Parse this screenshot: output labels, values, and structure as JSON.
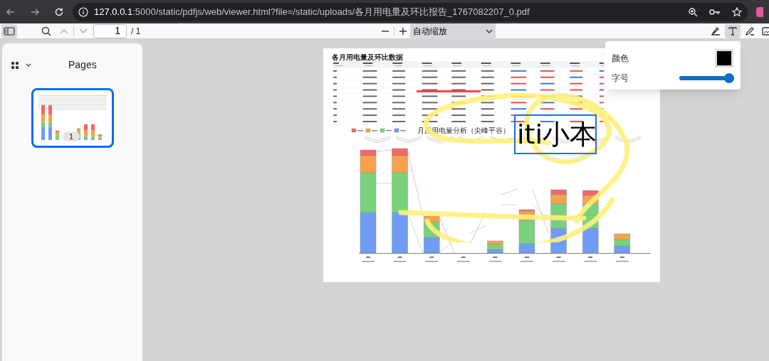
{
  "browser": {
    "url_host": "127.0.0.1",
    "url_rest": ":5000/static/pdfjs/web/viewer.html?file=/static/uploads/各月用电量及环比报告_1767082207_0.pdf"
  },
  "toolbar": {
    "sidebar_open": true,
    "page_number": "1",
    "page_count": "/ 1",
    "zoom": "自动缩放",
    "tools": [
      {
        "kind": "highlight",
        "selected": false
      },
      {
        "kind": "text",
        "selected": true
      },
      {
        "kind": "ink",
        "selected": false
      },
      {
        "kind": "image",
        "selected": false
      }
    ]
  },
  "sidebar": {
    "title": "Pages",
    "thumbnails": [
      {
        "label": "1",
        "selected": true
      }
    ]
  },
  "document": {
    "title": "各月用电量及环比数据",
    "chart": {
      "title": "月度用电量分析（尖峰平谷）"
    },
    "text_annotation": "iti小本"
  },
  "popup": {
    "color_label": "颜色",
    "color": "#000000",
    "size_label": "字号",
    "size_slider": {
      "level": 1
    }
  }
}
